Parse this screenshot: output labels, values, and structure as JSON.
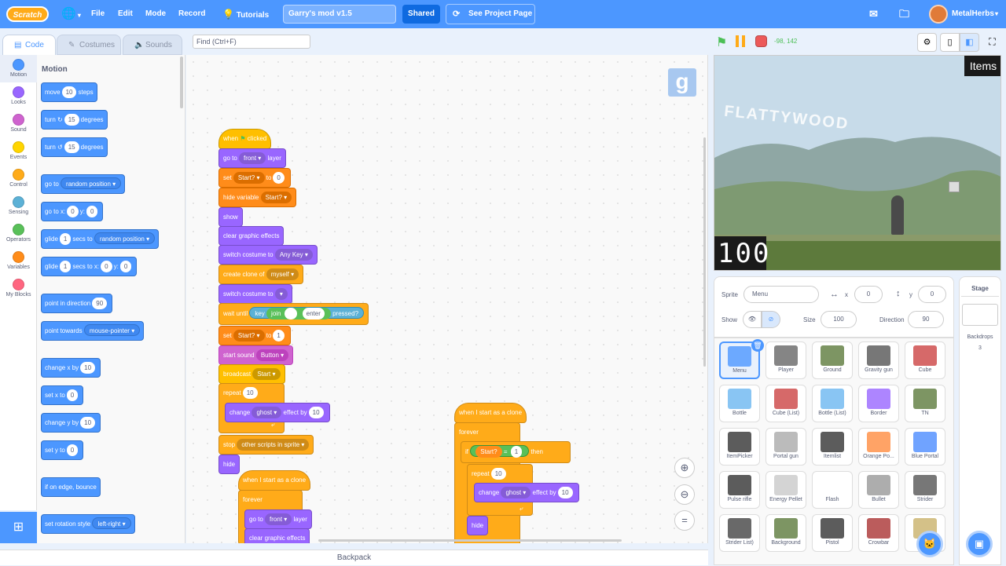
{
  "menu": {
    "logo": "Scratch",
    "file": "File",
    "edit": "Edit",
    "mode": "Mode",
    "record": "Record",
    "tutorials": "Tutorials",
    "project_title": "Garry's mod v1.5",
    "shared": "Shared",
    "see_project": "See Project Page",
    "username": "MetalHerbs"
  },
  "tabs": {
    "code": "Code",
    "costumes": "Costumes",
    "sounds": "Sounds"
  },
  "find_placeholder": "Find (Ctrl+F)",
  "categories": [
    {
      "label": "Motion",
      "color": "#4c97ff"
    },
    {
      "label": "Looks",
      "color": "#9966ff"
    },
    {
      "label": "Sound",
      "color": "#cf63cf"
    },
    {
      "label": "Events",
      "color": "#ffd500"
    },
    {
      "label": "Control",
      "color": "#ffab19"
    },
    {
      "label": "Sensing",
      "color": "#5cb1d6"
    },
    {
      "label": "Operators",
      "color": "#59c059"
    },
    {
      "label": "Variables",
      "color": "#ff8c1a"
    },
    {
      "label": "My Blocks",
      "color": "#ff6680"
    }
  ],
  "palette": {
    "heading": "Motion",
    "move": "move",
    "move_val": "10",
    "steps": "steps",
    "turn": "turn",
    "turn_val": "15",
    "degrees": "degrees",
    "goto": "go to",
    "random_position": "random position",
    "goto_xy": "go to x:",
    "x0": "0",
    "y_lbl": "y:",
    "y0": "0",
    "glide": "glide",
    "glide_val": "1",
    "secs_to": "secs to",
    "secs_to_x": "secs to x:",
    "point_dir": "point in direction",
    "dir_val": "90",
    "point_towards": "point towards",
    "mouse_pointer": "mouse-pointer",
    "change_x": "change x by",
    "change_y": "change y by",
    "set_x": "set x to",
    "set_y": "set y to",
    "edge_bounce": "if on edge, bounce",
    "rot_style": "set rotation style",
    "left_right": "left-right"
  },
  "script": {
    "when": "when",
    "clicked": "clicked",
    "goto": "go to",
    "front": "front",
    "layer": "layer",
    "set": "set",
    "start_var": "Start?",
    "to": "to",
    "zero": "0",
    "one": "1",
    "hide_variable": "hide variable",
    "show": "show",
    "clear_effects": "clear graphic effects",
    "switch_costume": "switch costume to",
    "any_key": "Any Key",
    "create_clone": "create clone of",
    "myself": "myself",
    "wait_until": "wait until",
    "key": "key",
    "join": "join",
    "enter": "enter",
    "pressed": "pressed?",
    "start_sound": "start sound",
    "button": "Button",
    "broadcast": "broadcast",
    "start_msg": "Start",
    "repeat": "repeat",
    "ten": "10",
    "change": "change",
    "ghost": "ghost",
    "effect_by": "effect by",
    "stop": "stop",
    "other_scripts": "other scripts in sprite",
    "hide": "hide",
    "clone_start": "when I start as a clone",
    "forever": "forever",
    "if": "if",
    "eq": "=",
    "then": "then"
  },
  "stage": {
    "coords": "-98, 142",
    "items_label": "Items",
    "title_text": "FLATTYWOOD",
    "counter": "100",
    "g_logo": "g"
  },
  "sprite_info": {
    "sprite_lbl": "Sprite",
    "sprite_name": "Menu",
    "x_lbl": "x",
    "x_val": "0",
    "y_lbl": "y",
    "y_val": "0",
    "show_lbl": "Show",
    "size_lbl": "Size",
    "size_val": "100",
    "dir_lbl": "Direction",
    "dir_val": "90"
  },
  "sprites": [
    "Menu",
    "Player",
    "Ground",
    "Gravity gun",
    "Cube",
    "Bottle",
    "Cube (List)",
    "Bottle (List)",
    "Border",
    "TN",
    "ItemPicker",
    "Portal gun",
    "Itemlist",
    "Orange Po...",
    "Blue Portal",
    "Pulse rifle",
    "Energy Pellet",
    "Flash",
    "Bullet",
    "Strider",
    "Strider List)",
    "Background",
    "Pistol",
    "Crowbar",
    ""
  ],
  "stage_panel": {
    "title": "Stage",
    "backdrops": "Backdrops",
    "backdrop_count": "3"
  },
  "backpack": "Backpack"
}
